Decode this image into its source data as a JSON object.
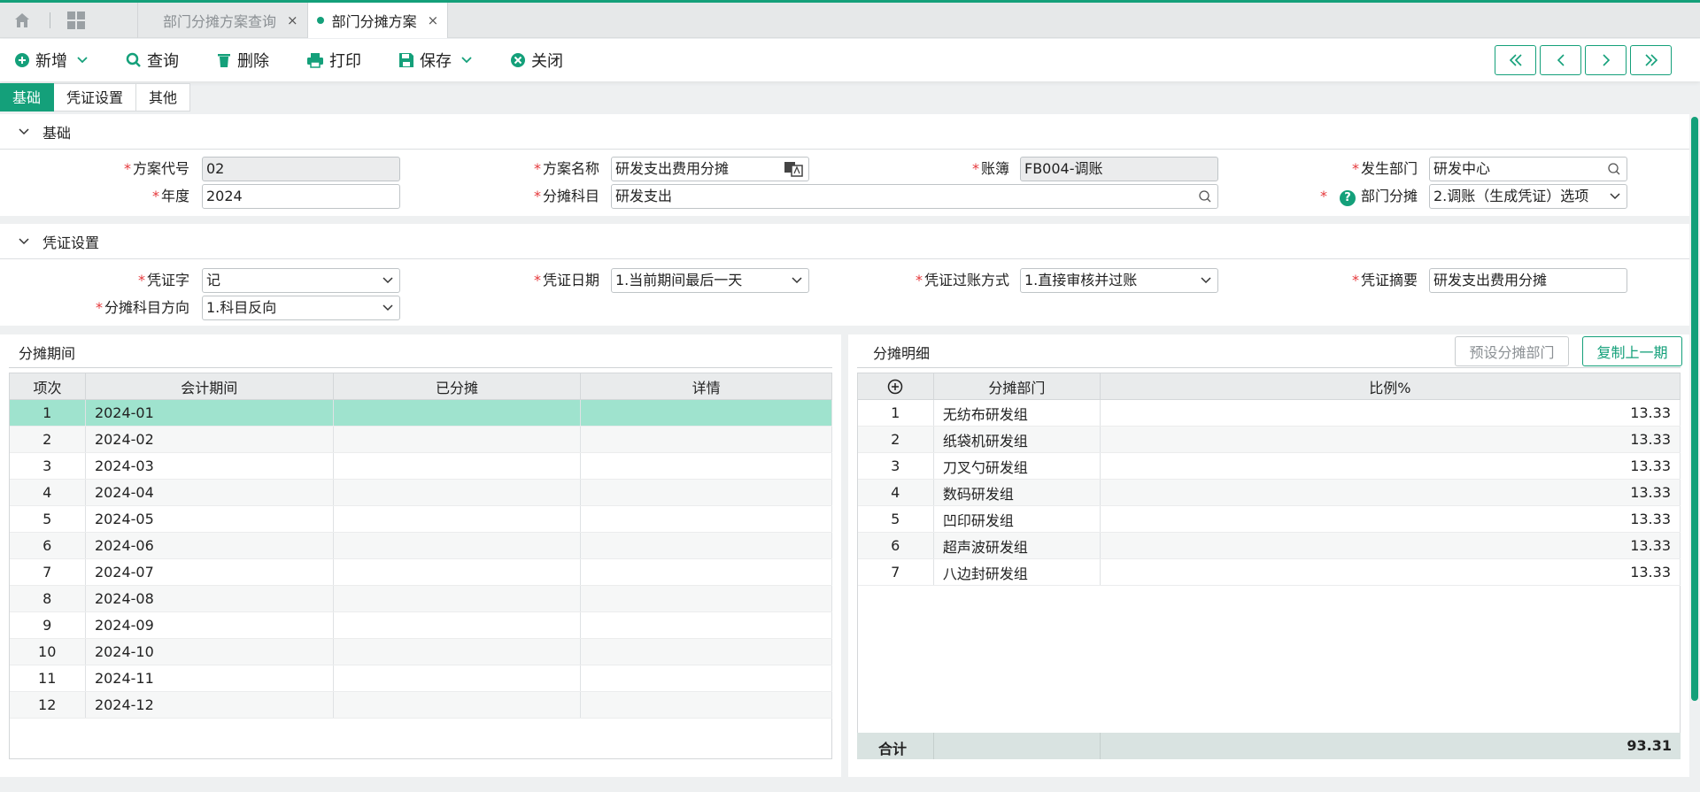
{
  "tabbar": {
    "tabs": [
      {
        "label": "部门分摊方案查询",
        "close": "×"
      },
      {
        "label": "部门分摊方案",
        "close": "×"
      }
    ]
  },
  "toolbar": {
    "add": "新增",
    "query": "查询",
    "delete": "删除",
    "print": "打印",
    "save": "保存",
    "close": "关闭"
  },
  "subtabs": [
    "基础",
    "凭证设置",
    "其他"
  ],
  "basic": {
    "title": "基础",
    "scheme_code_label": "方案代号",
    "scheme_code": "02",
    "scheme_name_label": "方案名称",
    "scheme_name": "研发支出费用分摊",
    "ledger_label": "账簿",
    "ledger": "FB004-调账",
    "dept_label": "发生部门",
    "dept": "研发中心",
    "year_label": "年度",
    "year": "2024",
    "subject_label": "分摊科目",
    "subject": "研发支出",
    "dept_alloc_label": "部门分摊",
    "dept_alloc": "2.调账（生成凭证）选项",
    "help": "?"
  },
  "voucher": {
    "title": "凭证设置",
    "word_label": "凭证字",
    "word": "记",
    "date_label": "凭证日期",
    "date": "1.当前期间最后一天",
    "posting_label": "凭证过账方式",
    "posting": "1.直接审核并过账",
    "summary_label": "凭证摘要",
    "summary": "研发支出费用分摊",
    "direction_label": "分摊科目方向",
    "direction": "1.科目反向"
  },
  "periods": {
    "title": "分摊期间",
    "columns": [
      "项次",
      "会计期间",
      "已分摊",
      "详情"
    ],
    "rows": [
      [
        "1",
        "2024-01",
        "",
        ""
      ],
      [
        "2",
        "2024-02",
        "",
        ""
      ],
      [
        "3",
        "2024-03",
        "",
        ""
      ],
      [
        "4",
        "2024-04",
        "",
        ""
      ],
      [
        "5",
        "2024-05",
        "",
        ""
      ],
      [
        "6",
        "2024-06",
        "",
        ""
      ],
      [
        "7",
        "2024-07",
        "",
        ""
      ],
      [
        "8",
        "2024-08",
        "",
        ""
      ],
      [
        "9",
        "2024-09",
        "",
        ""
      ],
      [
        "10",
        "2024-10",
        "",
        ""
      ],
      [
        "11",
        "2024-11",
        "",
        ""
      ],
      [
        "12",
        "2024-12",
        "",
        ""
      ]
    ]
  },
  "details": {
    "title": "分摊明细",
    "preset_button": "预设分摊部门",
    "copy_button": "复制上一期",
    "columns": [
      "",
      "分摊部门",
      "比例%"
    ],
    "rows": [
      [
        "1",
        "无纺布研发组",
        "13.33"
      ],
      [
        "2",
        "纸袋机研发组",
        "13.33"
      ],
      [
        "3",
        "刀叉勺研发组",
        "13.33"
      ],
      [
        "4",
        "数码研发组",
        "13.33"
      ],
      [
        "5",
        "凹印研发组",
        "13.33"
      ],
      [
        "6",
        "超声波研发组",
        "13.33"
      ],
      [
        "7",
        "八边封研发组",
        "13.33"
      ]
    ],
    "total_label": "合计",
    "total": "93.31"
  },
  "colors": {
    "accent": "#14a07a",
    "selected_row": "#9fe3ce",
    "required": "#e5383b"
  }
}
